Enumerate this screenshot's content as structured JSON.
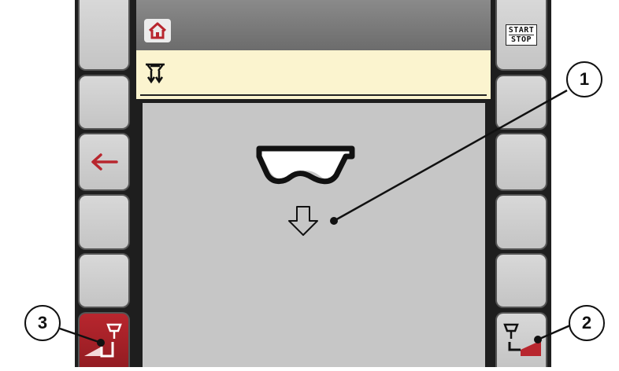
{
  "toolbar": {
    "start_stop_top": "START",
    "start_stop_bottom": "STOP"
  },
  "callouts": [
    "1",
    "2",
    "3"
  ],
  "icons": {
    "home": "home-icon",
    "title": "metering-slides-icon",
    "back": "back-arrow-icon",
    "hopper": "hopper-icon",
    "down": "down-arrow-icon",
    "left_side": "left-side-spread-icon",
    "right_side": "right-side-spread-icon"
  },
  "colors": {
    "accent": "#b8262e",
    "title_background": "#fbf4cf",
    "content_background": "#c6c6c6"
  }
}
